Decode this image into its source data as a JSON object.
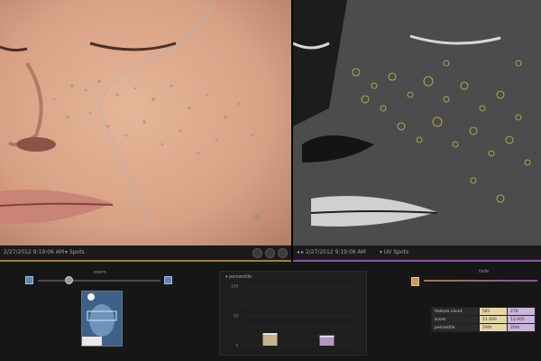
{
  "viewer": {
    "left": {
      "timestamp": "2/27/2012 9:19:06 AM",
      "mode_label": "▾ Spots",
      "accent": "#a37d3b"
    },
    "right": {
      "timestamp": "◂ ▸ 2/27/2012 9:19:06 AM",
      "mode_label": "▾ UV Spots",
      "accent": "#8a4fa8"
    }
  },
  "panel": {
    "zoom_label": "zoom",
    "fade_label": "fade",
    "percentile_chart": {
      "title_label": "▾ percentile",
      "accent_colors": [
        "#b89d66",
        "#9b7fae"
      ]
    },
    "features_table": {
      "rows": [
        {
          "name": "feature count",
          "a": "581",
          "b": "278"
        },
        {
          "name": "score",
          "a": "21.000",
          "b": "13.005"
        },
        {
          "name": "percentile",
          "a": "29th",
          "b": "20th"
        }
      ]
    }
  },
  "chart_data": {
    "type": "bar",
    "categories": [
      "",
      ""
    ],
    "series": [
      {
        "values": [
          18,
          14
        ]
      }
    ],
    "y_tick_labels": [
      "100",
      "50",
      "0"
    ],
    "ylim": [
      0,
      100
    ],
    "colors": [
      "#c9b487",
      "#b494c4"
    ]
  }
}
